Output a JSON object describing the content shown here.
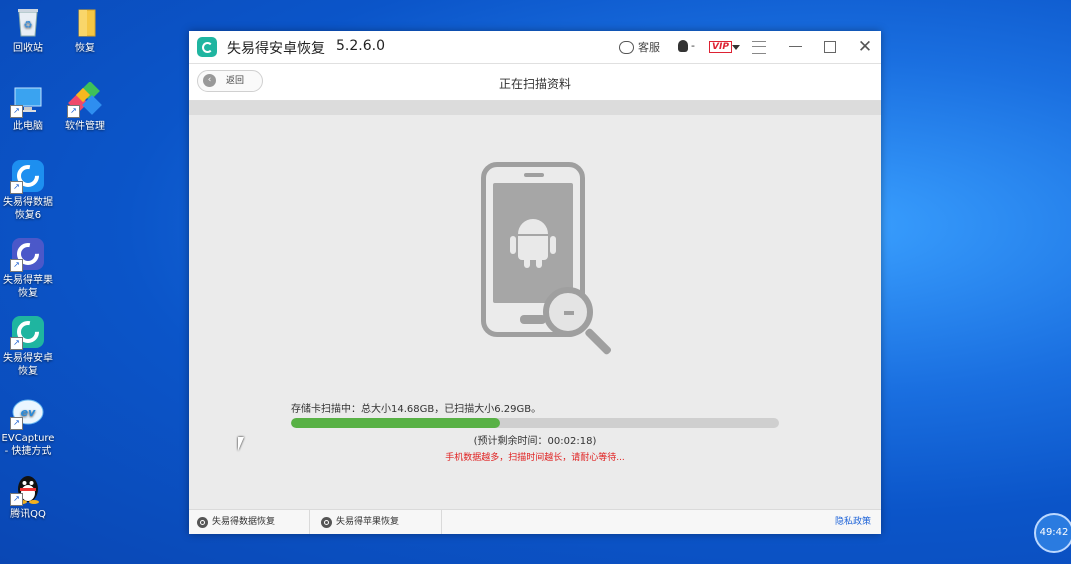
{
  "desktop": {
    "icons": [
      {
        "label": "回收站"
      },
      {
        "label": "恢复"
      },
      {
        "label": "此电脑"
      },
      {
        "label": "软件管理"
      },
      {
        "label": "失易得数据恢复6"
      },
      {
        "label": "失易得苹果恢复"
      },
      {
        "label": "失易得安卓恢复"
      },
      {
        "label": "EVCapture - 快捷方式"
      },
      {
        "label": "腾讯QQ"
      }
    ],
    "clock_badge": "49:42"
  },
  "window": {
    "app_name": "失易得安卓恢复",
    "version": "5.2.6.0",
    "service_label": "客服",
    "user_dash": "-",
    "vip_label": "VIP",
    "back_label": "返回",
    "nav_title": "正在扫描资料",
    "scan_status": "存储卡扫描中：总大小14.68GB，已扫描大小6.29GB。",
    "progress_fraction": 0.428,
    "remaining_time": "(预计剩余时间：00:02:18)",
    "warning": "手机数据越多，扫描时间越长，请耐心等待...",
    "footer": {
      "item1": "失易得数据恢复",
      "item2": "失易得苹果恢复",
      "privacy": "隐私政策"
    }
  },
  "colors": {
    "accent": "#1fb5a0",
    "progress": "#58b145",
    "warning": "#e02020",
    "link": "#1f64d8"
  }
}
